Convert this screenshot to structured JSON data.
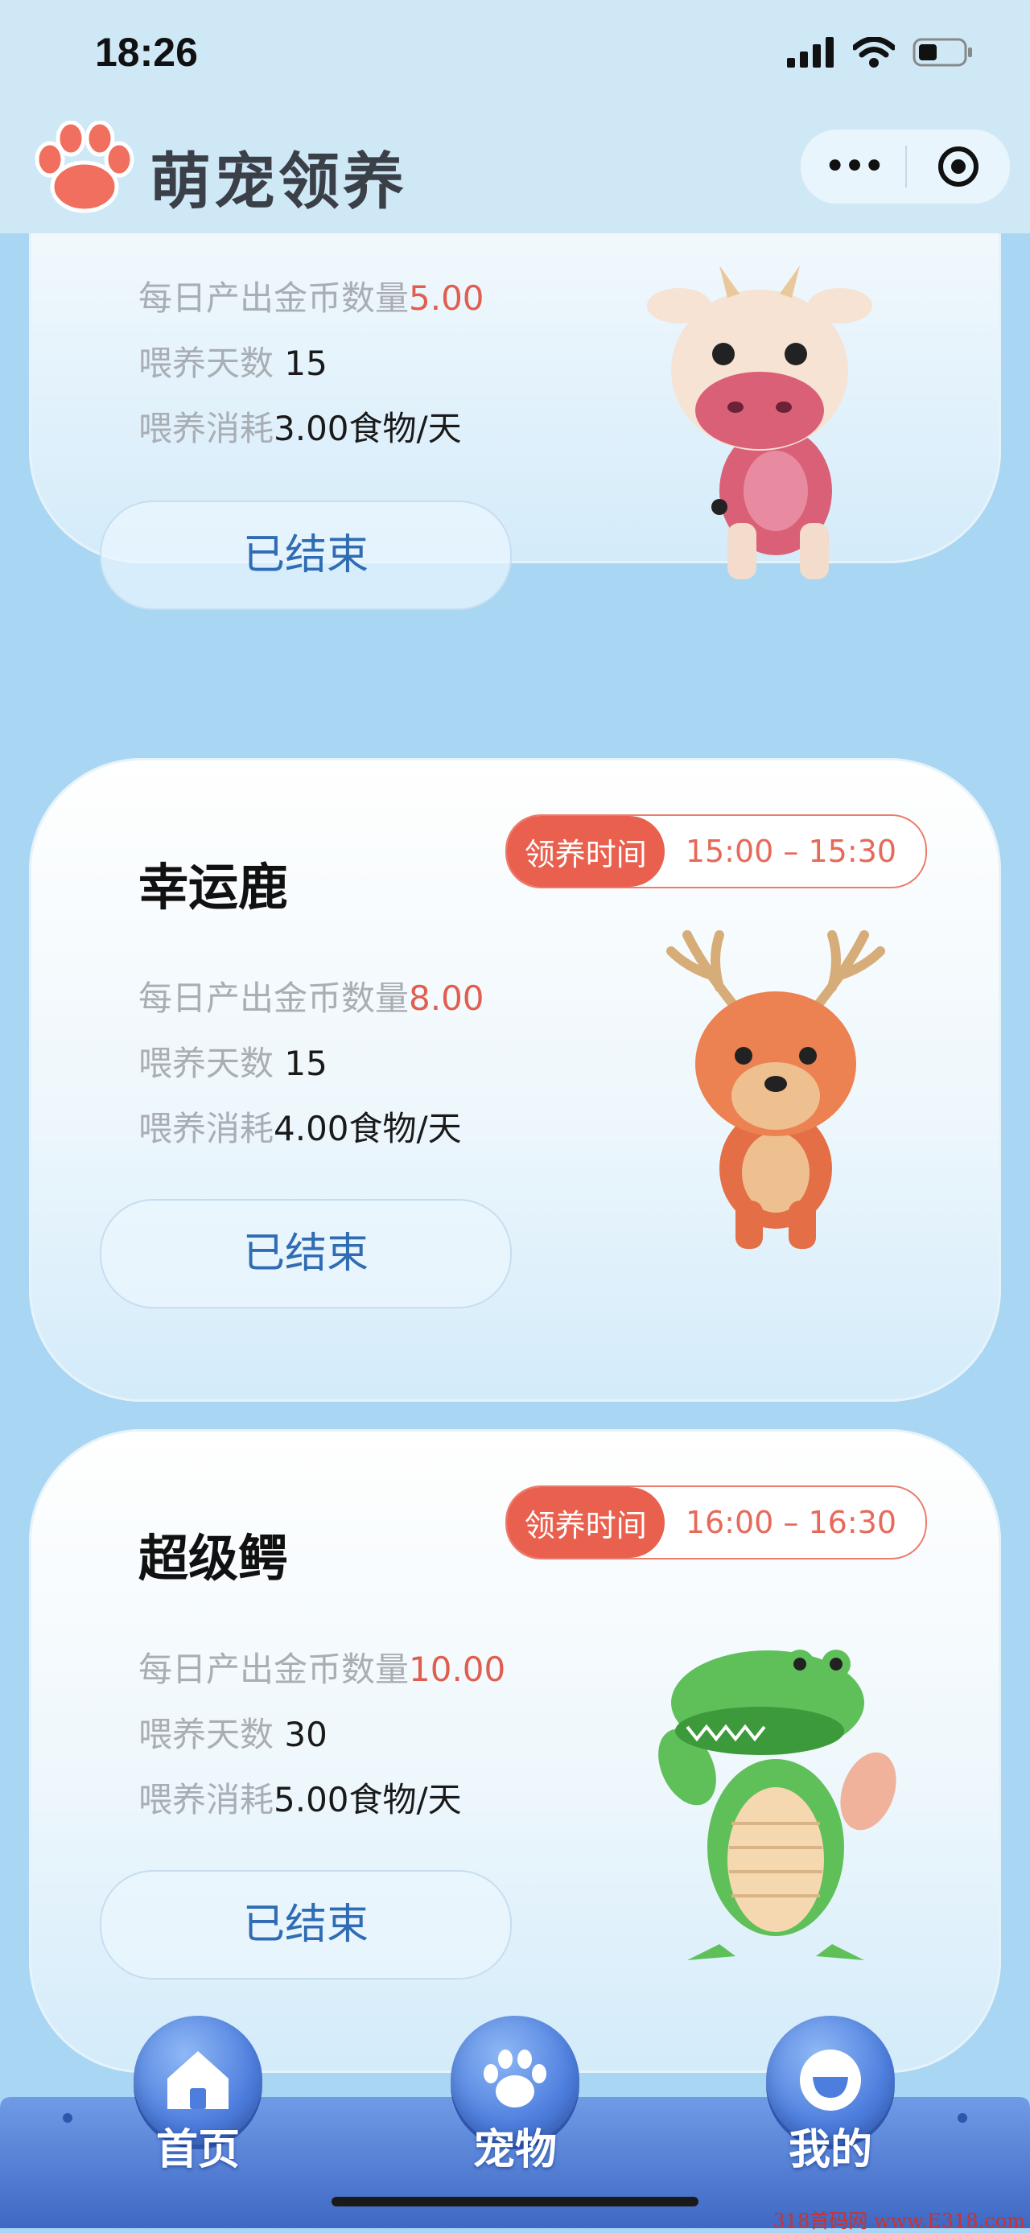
{
  "status_bar": {
    "time": "18:26"
  },
  "header": {
    "title": "萌宠领养",
    "more_label": "•••"
  },
  "labels": {
    "time_tag": "领养时间",
    "daily_output": "每日产出金币数量",
    "feed_days": "喂养天数",
    "feed_cost": "喂养消耗",
    "feed_unit": "食物/天"
  },
  "pets": [
    {
      "name": "",
      "time_range": "",
      "daily_output": "5.00",
      "feed_days": "15",
      "feed_cost": "3.00",
      "button": "已结束",
      "icon": "cow-character"
    },
    {
      "name": "幸运鹿",
      "time_range": "15:00 – 15:30",
      "daily_output": "8.00",
      "feed_days": "15",
      "feed_cost": "4.00",
      "button": "已结束",
      "icon": "deer-character"
    },
    {
      "name": "超级鳄",
      "time_range": "16:00 – 16:30",
      "daily_output": "10.00",
      "feed_days": "30",
      "feed_cost": "5.00",
      "button": "已结束",
      "icon": "crocodile-character"
    }
  ],
  "tabs": [
    {
      "label": "首页",
      "icon": "home-icon"
    },
    {
      "label": "宠物",
      "icon": "paw-icon"
    },
    {
      "label": "我的",
      "icon": "profile-icon"
    }
  ],
  "watermark": "318首码网 www.E318.com",
  "colors": {
    "accent_red": "#e9604f",
    "button_text": "#2f6cb3",
    "background": "#a9d6f3"
  }
}
